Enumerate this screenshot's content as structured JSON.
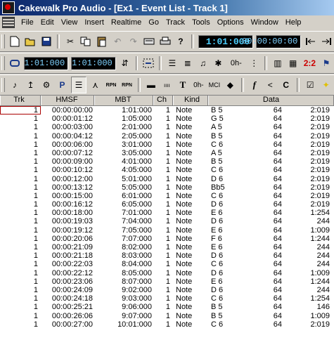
{
  "window": {
    "title": "Cakewalk Pro Audio - [Ex1 - Event List - Track 1]"
  },
  "menu": [
    "File",
    "Edit",
    "View",
    "Insert",
    "Realtime",
    "Go",
    "Track",
    "Tools",
    "Options",
    "Window",
    "Help"
  ],
  "toolbar1": {
    "lcd_mbt": "1:01:000",
    "lcd_smpte": "00:00:00:00"
  },
  "toolbar2": {
    "from_time": "1:01:000",
    "thru_time": "1:01:000",
    "controller_label": "0h-",
    "two_two": "2:2"
  },
  "toolbar3": {
    "rpn_label": "RPN",
    "nrpn_label": "RPN",
    "text_label": "T",
    "on_label": "0h-",
    "mci_label": "MCI",
    "expr_label": "f",
    "lt_label": "<",
    "c_label": "C"
  },
  "columns": [
    "Trk",
    "HMSF",
    "MBT",
    "Ch",
    "Kind",
    "Data"
  ],
  "events": [
    {
      "trk": "1",
      "hmsf": "00:00:00:00",
      "mbt": "1:01:000",
      "ch": "1",
      "kind": "Note",
      "note": "B 5",
      "vel": "64",
      "dur": "2:019"
    },
    {
      "trk": "1",
      "hmsf": "00:00:01:12",
      "mbt": "1:05:000",
      "ch": "1",
      "kind": "Note",
      "note": "G 5",
      "vel": "64",
      "dur": "2:019"
    },
    {
      "trk": "1",
      "hmsf": "00:00:03:00",
      "mbt": "2:01:000",
      "ch": "1",
      "kind": "Note",
      "note": "A 5",
      "vel": "64",
      "dur": "2:019"
    },
    {
      "trk": "1",
      "hmsf": "00:00:04:12",
      "mbt": "2:05:000",
      "ch": "1",
      "kind": "Note",
      "note": "B 5",
      "vel": "64",
      "dur": "2:019"
    },
    {
      "trk": "1",
      "hmsf": "00:00:06:00",
      "mbt": "3:01:000",
      "ch": "1",
      "kind": "Note",
      "note": "C 6",
      "vel": "64",
      "dur": "2:019"
    },
    {
      "trk": "1",
      "hmsf": "00:00:07:12",
      "mbt": "3:05:000",
      "ch": "1",
      "kind": "Note",
      "note": "A 5",
      "vel": "64",
      "dur": "2:019"
    },
    {
      "trk": "1",
      "hmsf": "00:00:09:00",
      "mbt": "4:01:000",
      "ch": "1",
      "kind": "Note",
      "note": "B 5",
      "vel": "64",
      "dur": "2:019"
    },
    {
      "trk": "1",
      "hmsf": "00:00:10:12",
      "mbt": "4:05:000",
      "ch": "1",
      "kind": "Note",
      "note": "C 6",
      "vel": "64",
      "dur": "2:019"
    },
    {
      "trk": "1",
      "hmsf": "00:00:12:00",
      "mbt": "5:01:000",
      "ch": "1",
      "kind": "Note",
      "note": "D 6",
      "vel": "64",
      "dur": "2:019"
    },
    {
      "trk": "1",
      "hmsf": "00:00:13:12",
      "mbt": "5:05:000",
      "ch": "1",
      "kind": "Note",
      "note": "Bb5",
      "vel": "64",
      "dur": "2:019"
    },
    {
      "trk": "1",
      "hmsf": "00:00:15:00",
      "mbt": "6:01:000",
      "ch": "1",
      "kind": "Note",
      "note": "C 6",
      "vel": "64",
      "dur": "2:019"
    },
    {
      "trk": "1",
      "hmsf": "00:00:16:12",
      "mbt": "6:05:000",
      "ch": "1",
      "kind": "Note",
      "note": "D 6",
      "vel": "64",
      "dur": "2:019"
    },
    {
      "trk": "1",
      "hmsf": "00:00:18:00",
      "mbt": "7:01:000",
      "ch": "1",
      "kind": "Note",
      "note": "E 6",
      "vel": "64",
      "dur": "1:254"
    },
    {
      "trk": "1",
      "hmsf": "00:00:19:03",
      "mbt": "7:04:000",
      "ch": "1",
      "kind": "Note",
      "note": "D 6",
      "vel": "64",
      "dur": "244"
    },
    {
      "trk": "1",
      "hmsf": "00:00:19:12",
      "mbt": "7:05:000",
      "ch": "1",
      "kind": "Note",
      "note": "E 6",
      "vel": "64",
      "dur": "1:009"
    },
    {
      "trk": "1",
      "hmsf": "00:00:20:06",
      "mbt": "7:07:000",
      "ch": "1",
      "kind": "Note",
      "note": "F 6",
      "vel": "64",
      "dur": "1:244"
    },
    {
      "trk": "1",
      "hmsf": "00:00:21:09",
      "mbt": "8:02:000",
      "ch": "1",
      "kind": "Note",
      "note": "E 6",
      "vel": "64",
      "dur": "244"
    },
    {
      "trk": "1",
      "hmsf": "00:00:21:18",
      "mbt": "8:03:000",
      "ch": "1",
      "kind": "Note",
      "note": "D 6",
      "vel": "64",
      "dur": "244"
    },
    {
      "trk": "1",
      "hmsf": "00:00:22:03",
      "mbt": "8:04:000",
      "ch": "1",
      "kind": "Note",
      "note": "C 6",
      "vel": "64",
      "dur": "244"
    },
    {
      "trk": "1",
      "hmsf": "00:00:22:12",
      "mbt": "8:05:000",
      "ch": "1",
      "kind": "Note",
      "note": "D 6",
      "vel": "64",
      "dur": "1:009"
    },
    {
      "trk": "1",
      "hmsf": "00:00:23:06",
      "mbt": "8:07:000",
      "ch": "1",
      "kind": "Note",
      "note": "E 6",
      "vel": "64",
      "dur": "1:244"
    },
    {
      "trk": "1",
      "hmsf": "00:00:24:09",
      "mbt": "9:02:000",
      "ch": "1",
      "kind": "Note",
      "note": "D 6",
      "vel": "64",
      "dur": "244"
    },
    {
      "trk": "1",
      "hmsf": "00:00:24:18",
      "mbt": "9:03:000",
      "ch": "1",
      "kind": "Note",
      "note": "C 6",
      "vel": "64",
      "dur": "1:254"
    },
    {
      "trk": "1",
      "hmsf": "00:00:25:21",
      "mbt": "9:06:000",
      "ch": "1",
      "kind": "Note",
      "note": "B 5",
      "vel": "64",
      "dur": "146"
    },
    {
      "trk": "1",
      "hmsf": "00:00:26:06",
      "mbt": "9:07:000",
      "ch": "1",
      "kind": "Note",
      "note": "B 5",
      "vel": "64",
      "dur": "1:009"
    },
    {
      "trk": "1",
      "hmsf": "00:00:27:00",
      "mbt": "10:01:000",
      "ch": "1",
      "kind": "Note",
      "note": "C 6",
      "vel": "64",
      "dur": "2:019"
    }
  ]
}
